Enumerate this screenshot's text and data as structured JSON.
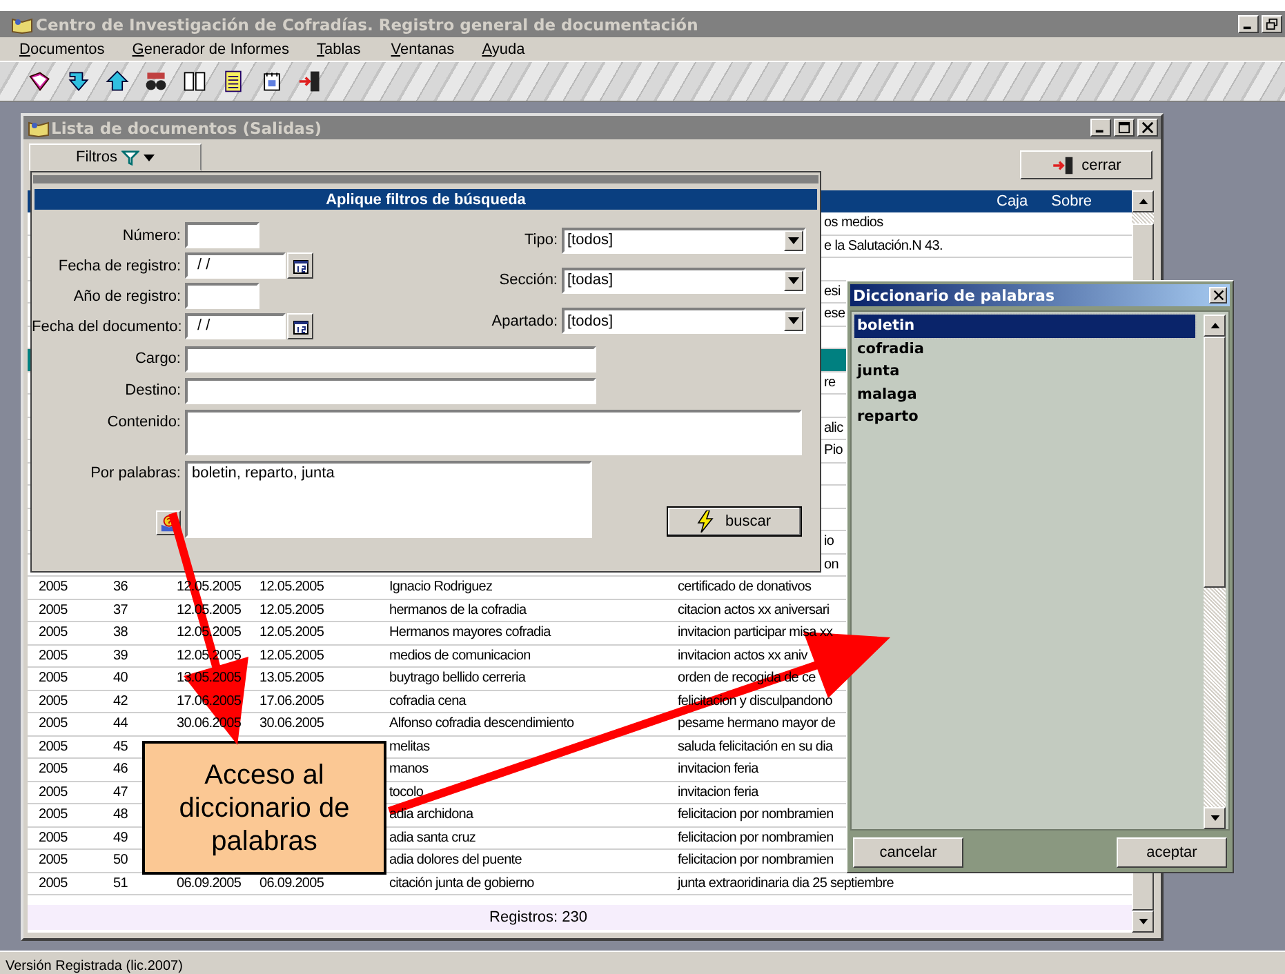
{
  "app_window": {
    "title": "Centro de Investigación de Cofradías. Registro general de documentación"
  },
  "menu": [
    "Documentos",
    "Generador de Informes",
    "Tablas",
    "Ventanas",
    "Ayuda"
  ],
  "child_window": {
    "title": "Lista de documentos (Salidas)",
    "filter_tab": "Filtros",
    "close_button": "cerrar",
    "header_columns": [
      "Caja",
      "Sobre"
    ],
    "upper_rows": [
      {
        "text": "os medios",
        "selected": false
      },
      {
        "text": "e la Salutación.N 43.",
        "selected": false
      },
      {
        "selected": false
      },
      {
        "text": "esi",
        "selected": false
      },
      {
        "text": "ese",
        "selected": false
      },
      {
        "selected": false
      },
      {
        "selected": true
      },
      {
        "text": "re",
        "selected": false
      },
      {
        "selected": false
      },
      {
        "text": "alic",
        "selected": false
      },
      {
        "text": "Pio",
        "selected": false
      },
      {
        "selected": false
      },
      {
        "selected": false
      },
      {
        "selected": false
      },
      {
        "text": "io",
        "selected": false
      },
      {
        "text": "on",
        "selected": false
      }
    ],
    "rows": [
      {
        "year": "2005",
        "number": "36",
        "reg_date": "12.05.2005",
        "doc_date": "12.05.2005",
        "recipient": "Ignacio Rodriguez",
        "content": "certificado de donativos"
      },
      {
        "year": "2005",
        "number": "37",
        "reg_date": "12.05.2005",
        "doc_date": "12.05.2005",
        "recipient": "hermanos de la cofradia",
        "content": "citacion actos xx aniversari"
      },
      {
        "year": "2005",
        "number": "38",
        "reg_date": "12.05.2005",
        "doc_date": "12.05.2005",
        "recipient": "Hermanos mayores cofradia",
        "content": "invitacion participar misa xx"
      },
      {
        "year": "2005",
        "number": "39",
        "reg_date": "12.05.2005",
        "doc_date": "12.05.2005",
        "recipient": "medios de comunicacion",
        "content": "invitacion actos xx aniv"
      },
      {
        "year": "2005",
        "number": "40",
        "reg_date": "13.05.2005",
        "doc_date": "13.05.2005",
        "recipient": "buytrago bellido cerreria",
        "content": "orden de recogida de ce"
      },
      {
        "year": "2005",
        "number": "42",
        "reg_date": "17.06.2005",
        "doc_date": "17.06.2005",
        "recipient": "cofradia cena",
        "content": "felicitacion y disculpandono"
      },
      {
        "year": "2005",
        "number": "44",
        "reg_date": "30.06.2005",
        "doc_date": "30.06.2005",
        "recipient": "Alfonso cofradia descendimiento",
        "content": "pesame hermano mayor de"
      },
      {
        "year": "2005",
        "number": "45",
        "recipient": "melitas",
        "content": "saluda felicitación en su dia"
      },
      {
        "year": "2005",
        "number": "46",
        "recipient": "manos",
        "content": "invitacion feria"
      },
      {
        "year": "2005",
        "number": "47",
        "recipient": "tocolo",
        "content": "invitacion feria"
      },
      {
        "year": "2005",
        "number": "48",
        "recipient": "adia archidona",
        "content": "felicitacion por nombramien"
      },
      {
        "year": "2005",
        "number": "49",
        "recipient": "adia santa cruz",
        "content": "felicitacion por nombramien"
      },
      {
        "year": "2005",
        "number": "50",
        "recipient": "adia dolores del puente",
        "content": "felicitacion por nombramien"
      },
      {
        "year": "2005",
        "number": "51",
        "reg_date": "06.09.2005",
        "doc_date": "06.09.2005",
        "recipient": "citación junta de gobierno",
        "content": "junta extraoridinaria dia 25 septiembre"
      }
    ],
    "record_count": "Registros: 230"
  },
  "filter_panel": {
    "title": "Aplique filtros de búsqueda",
    "top_fields": [
      {
        "kind": "text",
        "label": "Número:"
      },
      {
        "kind": "date",
        "label": "Fecha de registro:",
        "value": "/ /"
      },
      {
        "kind": "text",
        "label": "Año de registro:"
      },
      {
        "kind": "date",
        "label": "Fecha del documento:",
        "value": "/ /"
      }
    ],
    "selects": [
      {
        "label": "Tipo:",
        "value": "[todos]"
      },
      {
        "label": "Sección:",
        "value": "[todas]"
      },
      {
        "label": "Apartado:",
        "value": "[todos]"
      }
    ],
    "wide_fields": [
      {
        "kind": "line",
        "label": "Cargo:"
      },
      {
        "kind": "line",
        "label": "Destino:"
      },
      {
        "kind": "area",
        "label": "Contenido:"
      }
    ],
    "words_field": {
      "label": "Por palabras:",
      "value": "boletin, reparto, junta"
    },
    "search_button": "buscar"
  },
  "dictionary": {
    "title": "Diccionario de palabras",
    "words": [
      {
        "text": "boletin",
        "selected": true
      },
      {
        "text": "cofradia",
        "selected": false
      },
      {
        "text": "junta",
        "selected": false
      },
      {
        "text": "malaga",
        "selected": false
      },
      {
        "text": "reparto",
        "selected": false
      }
    ],
    "cancel_button": "cancelar",
    "accept_button": "aceptar"
  },
  "callout": {
    "text": "Acceso al diccionario de palabras"
  },
  "status_bar": {
    "text": "Versión Registrada (lic.2007)"
  }
}
